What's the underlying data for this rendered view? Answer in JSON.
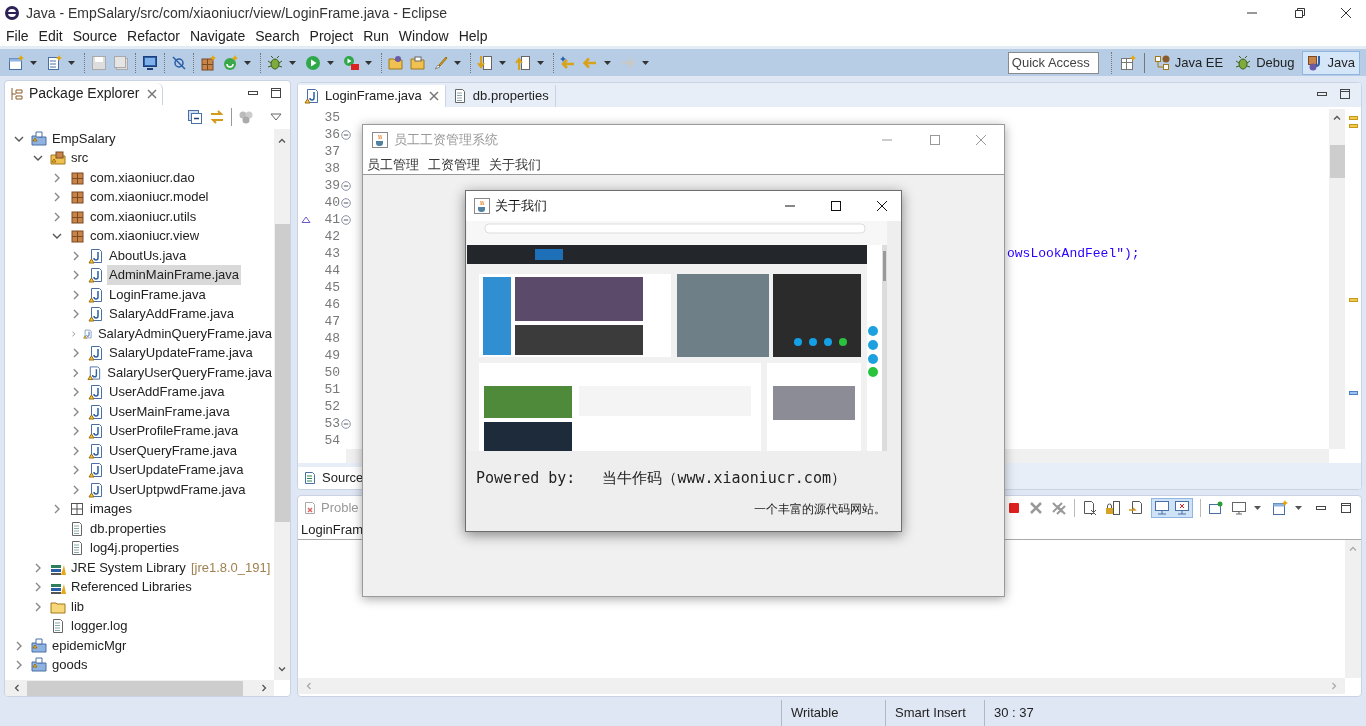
{
  "window": {
    "title": "Java - EmpSalary/src/com/xiaoniucr/view/LoginFrame.java - Eclipse"
  },
  "menu": [
    "File",
    "Edit",
    "Source",
    "Refactor",
    "Navigate",
    "Search",
    "Project",
    "Run",
    "Window",
    "Help"
  ],
  "quick_access": {
    "placeholder": "Quick Access"
  },
  "perspectives": [
    {
      "kind": "javaee",
      "label": "Java EE",
      "selected": false
    },
    {
      "kind": "debug",
      "label": "Debug",
      "selected": false
    },
    {
      "kind": "java",
      "label": "Java",
      "selected": true
    }
  ],
  "package_explorer": {
    "title": "Package Explorer",
    "tree": [
      {
        "label": "EmpSalary",
        "kind": "project",
        "expanded": true,
        "selected": false,
        "children": [
          {
            "label": "src",
            "kind": "source-folder",
            "expanded": true,
            "selected": false,
            "children": [
              {
                "label": "com.xiaoniucr.dao",
                "kind": "package",
                "expanded": false,
                "selected": false
              },
              {
                "label": "com.xiaoniucr.model",
                "kind": "package",
                "expanded": false,
                "selected": false
              },
              {
                "label": "com.xiaoniucr.utils",
                "kind": "package",
                "expanded": false,
                "selected": false
              },
              {
                "label": "com.xiaoniucr.view",
                "kind": "package",
                "expanded": true,
                "selected": false,
                "children": [
                  {
                    "label": "AboutUs.java",
                    "kind": "java-file",
                    "expanded": false,
                    "selected": false
                  },
                  {
                    "label": "AdminMainFrame.java",
                    "kind": "java-file",
                    "expanded": false,
                    "selected": true
                  },
                  {
                    "label": "LoginFrame.java",
                    "kind": "java-file",
                    "expanded": false,
                    "selected": false
                  },
                  {
                    "label": "SalaryAddFrame.java",
                    "kind": "java-file",
                    "expanded": false,
                    "selected": false
                  },
                  {
                    "label": "SalaryAdminQueryFrame.java",
                    "kind": "java-file",
                    "expanded": false,
                    "selected": false
                  },
                  {
                    "label": "SalaryUpdateFrame.java",
                    "kind": "java-file",
                    "expanded": false,
                    "selected": false
                  },
                  {
                    "label": "SalaryUserQueryFrame.java",
                    "kind": "java-file",
                    "expanded": false,
                    "selected": false
                  },
                  {
                    "label": "UserAddFrame.java",
                    "kind": "java-file",
                    "expanded": false,
                    "selected": false
                  },
                  {
                    "label": "UserMainFrame.java",
                    "kind": "java-file",
                    "expanded": false,
                    "selected": false
                  },
                  {
                    "label": "UserProfileFrame.java",
                    "kind": "java-file",
                    "expanded": false,
                    "selected": false
                  },
                  {
                    "label": "UserQueryFrame.java",
                    "kind": "java-file",
                    "expanded": false,
                    "selected": false
                  },
                  {
                    "label": "UserUpdateFrame.java",
                    "kind": "java-file",
                    "expanded": false,
                    "selected": false
                  },
                  {
                    "label": "UserUptpwdFrame.java",
                    "kind": "java-file",
                    "expanded": false,
                    "selected": false
                  }
                ]
              },
              {
                "label": "images",
                "kind": "resource-folder",
                "expanded": false,
                "selected": false
              },
              {
                "label": "db.properties",
                "kind": "file",
                "selected": false
              },
              {
                "label": "log4j.properties",
                "kind": "file",
                "selected": false
              }
            ]
          },
          {
            "label": "JRE System Library",
            "decoration": "[jre1.8.0_191]",
            "kind": "library",
            "expanded": false,
            "selected": false
          },
          {
            "label": "Referenced Libraries",
            "kind": "library",
            "expanded": false,
            "selected": false
          },
          {
            "label": "lib",
            "kind": "folder",
            "expanded": false,
            "selected": false
          },
          {
            "label": "logger.log",
            "kind": "file",
            "selected": false
          }
        ]
      },
      {
        "label": "epidemicMgr",
        "kind": "project",
        "expanded": false,
        "selected": false
      },
      {
        "label": "goods",
        "kind": "project",
        "expanded": false,
        "selected": false
      }
    ]
  },
  "editor": {
    "tabs": [
      {
        "label": "LoginFrame.java",
        "kind": "java",
        "selected": true
      },
      {
        "label": "db.properties",
        "kind": "properties",
        "selected": false
      }
    ],
    "lines": [
      {
        "number": "35",
        "fold": false
      },
      {
        "number": "36",
        "fold": true
      },
      {
        "number": "37",
        "fold": false
      },
      {
        "number": "38",
        "fold": false
      },
      {
        "number": "39",
        "fold": true
      },
      {
        "number": "40",
        "fold": true
      },
      {
        "number": "41",
        "fold": true,
        "override": true
      },
      {
        "number": "42",
        "fold": false
      },
      {
        "number": "43",
        "fold": false,
        "code": "owsLookAndFeel\");"
      },
      {
        "number": "44",
        "fold": false
      },
      {
        "number": "45",
        "fold": false
      },
      {
        "number": "46",
        "fold": false
      },
      {
        "number": "47",
        "fold": false
      },
      {
        "number": "48",
        "fold": false
      },
      {
        "number": "49",
        "fold": false
      },
      {
        "number": "50",
        "fold": false
      },
      {
        "number": "51",
        "fold": false
      },
      {
        "number": "52",
        "fold": false
      },
      {
        "number": "53",
        "fold": true
      },
      {
        "number": "54",
        "fold": false
      }
    ],
    "bottom_tab": "Source"
  },
  "bottom_panel": {
    "tab": "Proble",
    "column": "LoginFram"
  },
  "status_bar": [
    "Writable",
    "Smart Insert",
    "30 : 37"
  ],
  "app_frame": {
    "title": "员工工资管理系统",
    "menu": [
      "员工管理",
      "工资管理",
      "关于我们"
    ]
  },
  "about_dialog": {
    "title": "关于我们",
    "powered_by": "Powered by:   当牛作码（www.xiaoniucr.com）",
    "slogan": "一个丰富的源代码网站。"
  }
}
